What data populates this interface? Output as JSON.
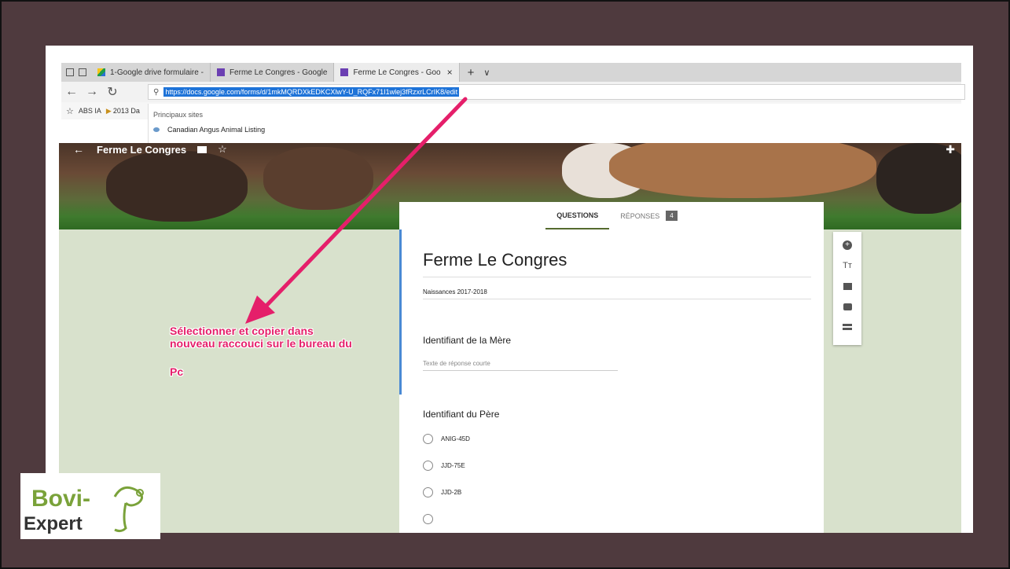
{
  "browser": {
    "tabs": [
      {
        "label": "1-Google drive formulaire -",
        "icon": "google-drive-icon"
      },
      {
        "label": "Ferme Le Congres - Google",
        "icon": "google-forms-icon"
      },
      {
        "label": "Ferme Le Congres - Goo",
        "icon": "google-forms-icon"
      }
    ],
    "tab_close": "×",
    "new_tab": "+",
    "tab_list": "∨",
    "url": "https://docs.google.com/forms/d/1mkMQRDXkEDKCXlwY-U_RQFx71I1wlej3fRzxrLCrIK8/edit",
    "favorites": [
      "ABS IA",
      "2013 Da"
    ],
    "dropdown_header": "Principaux sites",
    "dropdown_item": "Canadian Angus Animal Listing"
  },
  "form": {
    "header_title": "Ferme  Le Congres",
    "tabs": {
      "questions": "QUESTIONS",
      "responses": "RÉPONSES",
      "responses_count": "4"
    },
    "title": "Ferme  Le Congres",
    "description": "Naissances 2017-2018",
    "question1": "Identifiant de la Mère",
    "question1_placeholder": "Texte de réponse courte",
    "question2": "Identifiant du Père",
    "options": [
      "ANIG-45D",
      "JJD-75E",
      "JJD-2B"
    ]
  },
  "annotation": {
    "line1": "Sélectionner et copier dans",
    "line2": "nouveau raccouci sur le bureau du",
    "line3": "Pc",
    "color": "#e51f6a"
  },
  "logo": {
    "text1": "Bovi-",
    "text2": "Expert"
  },
  "colors": {
    "slide_bg": "#4f3a3e",
    "form_bg": "#d8e1cc",
    "accent": "#4a8ad4",
    "url_highlight": "#1e73d8"
  }
}
